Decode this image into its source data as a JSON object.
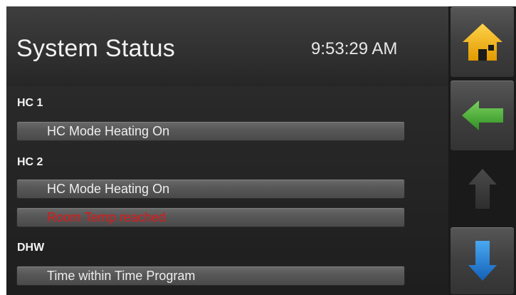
{
  "header": {
    "title": "System Status",
    "time": "9:53:29 AM"
  },
  "sections": [
    {
      "label": "HC 1",
      "statuses": [
        {
          "text": "HC Mode Heating On",
          "color": "#eeeeee"
        }
      ]
    },
    {
      "label": "HC 2",
      "statuses": [
        {
          "text": "HC Mode Heating On",
          "color": "#eeeeee"
        },
        {
          "text": "Room Temp reached",
          "color": "#e01818"
        }
      ]
    },
    {
      "label": "DHW",
      "statuses": [
        {
          "text": "Time within Time Program",
          "color": "#eeeeee"
        }
      ]
    }
  ],
  "sidebar": {
    "buttons": [
      {
        "icon": "home-icon",
        "color": "#f2b400",
        "enabled": true
      },
      {
        "icon": "arrow-left-icon",
        "color": "#3ea62f",
        "enabled": true
      },
      {
        "icon": "arrow-up-icon",
        "color": "#3c3c3c",
        "enabled": false
      },
      {
        "icon": "arrow-down-icon",
        "color": "#1e7fd6",
        "enabled": true
      }
    ]
  }
}
